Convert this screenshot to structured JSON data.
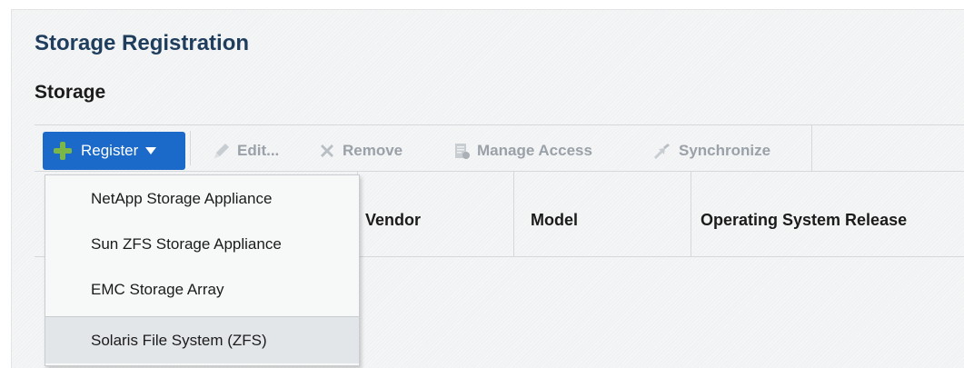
{
  "page": {
    "title": "Storage Registration",
    "section": "Storage"
  },
  "toolbar": {
    "register_label": "Register",
    "edit_label": "Edit...",
    "remove_label": "Remove",
    "manage_access_label": "Manage Access",
    "synchronize_label": "Synchronize"
  },
  "register_menu": {
    "items": [
      {
        "label": "NetApp Storage Appliance"
      },
      {
        "label": "Sun ZFS Storage Appliance"
      },
      {
        "label": "EMC Storage Array"
      },
      {
        "label": "Solaris File System (ZFS)"
      }
    ]
  },
  "table": {
    "columns": [
      "Vendor",
      "Model",
      "Operating System Release"
    ]
  },
  "colors": {
    "register_button": "#1b6ac9",
    "plus_icon": "#7ab648",
    "disabled_text": "#9aa1a8",
    "title": "#1f3d5c"
  }
}
